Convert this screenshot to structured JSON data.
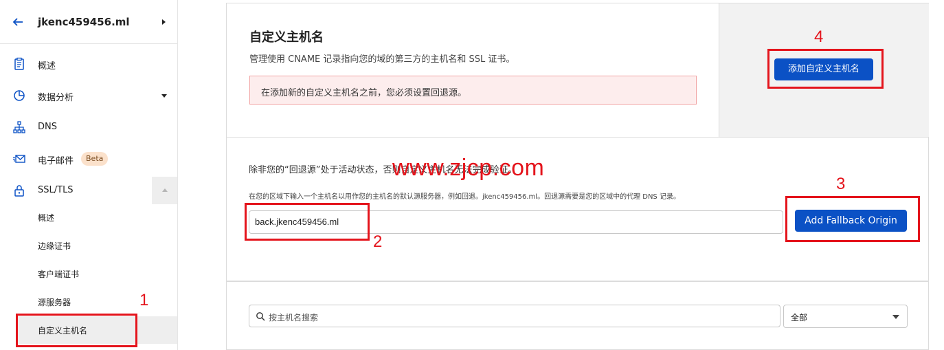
{
  "sidebar": {
    "domain": "jkenc459456.ml",
    "items": [
      {
        "label": "概述"
      },
      {
        "label": "数据分析"
      },
      {
        "label": "DNS"
      },
      {
        "label": "电子邮件",
        "badge": "Beta"
      },
      {
        "label": "SSL/TLS"
      }
    ],
    "ssl_sub_items": [
      {
        "label": "概述"
      },
      {
        "label": "边缘证书"
      },
      {
        "label": "客户端证书"
      },
      {
        "label": "源服务器"
      },
      {
        "label": "自定义主机名"
      }
    ]
  },
  "custom_hostnames": {
    "title": "自定义主机名",
    "description": "管理使用 CNAME 记录指向您的域的第三方的主机名和 SSL 证书。",
    "alert": "在添加新的自定义主机名之前，您必须设置回退源。",
    "add_button": "添加自定义主机名"
  },
  "fallback": {
    "description": "除非您的“回退源”处于活动状态，否则自定义主机名无法完成验证。",
    "hint": "在您的区域下输入一个主机名以用作您的主机名的默认源服务器，例如回退。jkenc459456.ml。回退源需要是您的区域中的代理 DNS 记录。",
    "input_value": "back.jkenc459456.ml",
    "button": "Add Fallback Origin"
  },
  "filter": {
    "search_placeholder": "按主机名搜索",
    "select_value": "全部"
  },
  "annotations": {
    "watermark": "www.zjcp.com",
    "numbers": [
      "1",
      "2",
      "3",
      "4"
    ]
  },
  "colors": {
    "primary_button": "#0b51c5",
    "annotation_red": "#e4141c",
    "alert_bg": "#fdeded",
    "beta_bg": "#fbe1cb"
  }
}
